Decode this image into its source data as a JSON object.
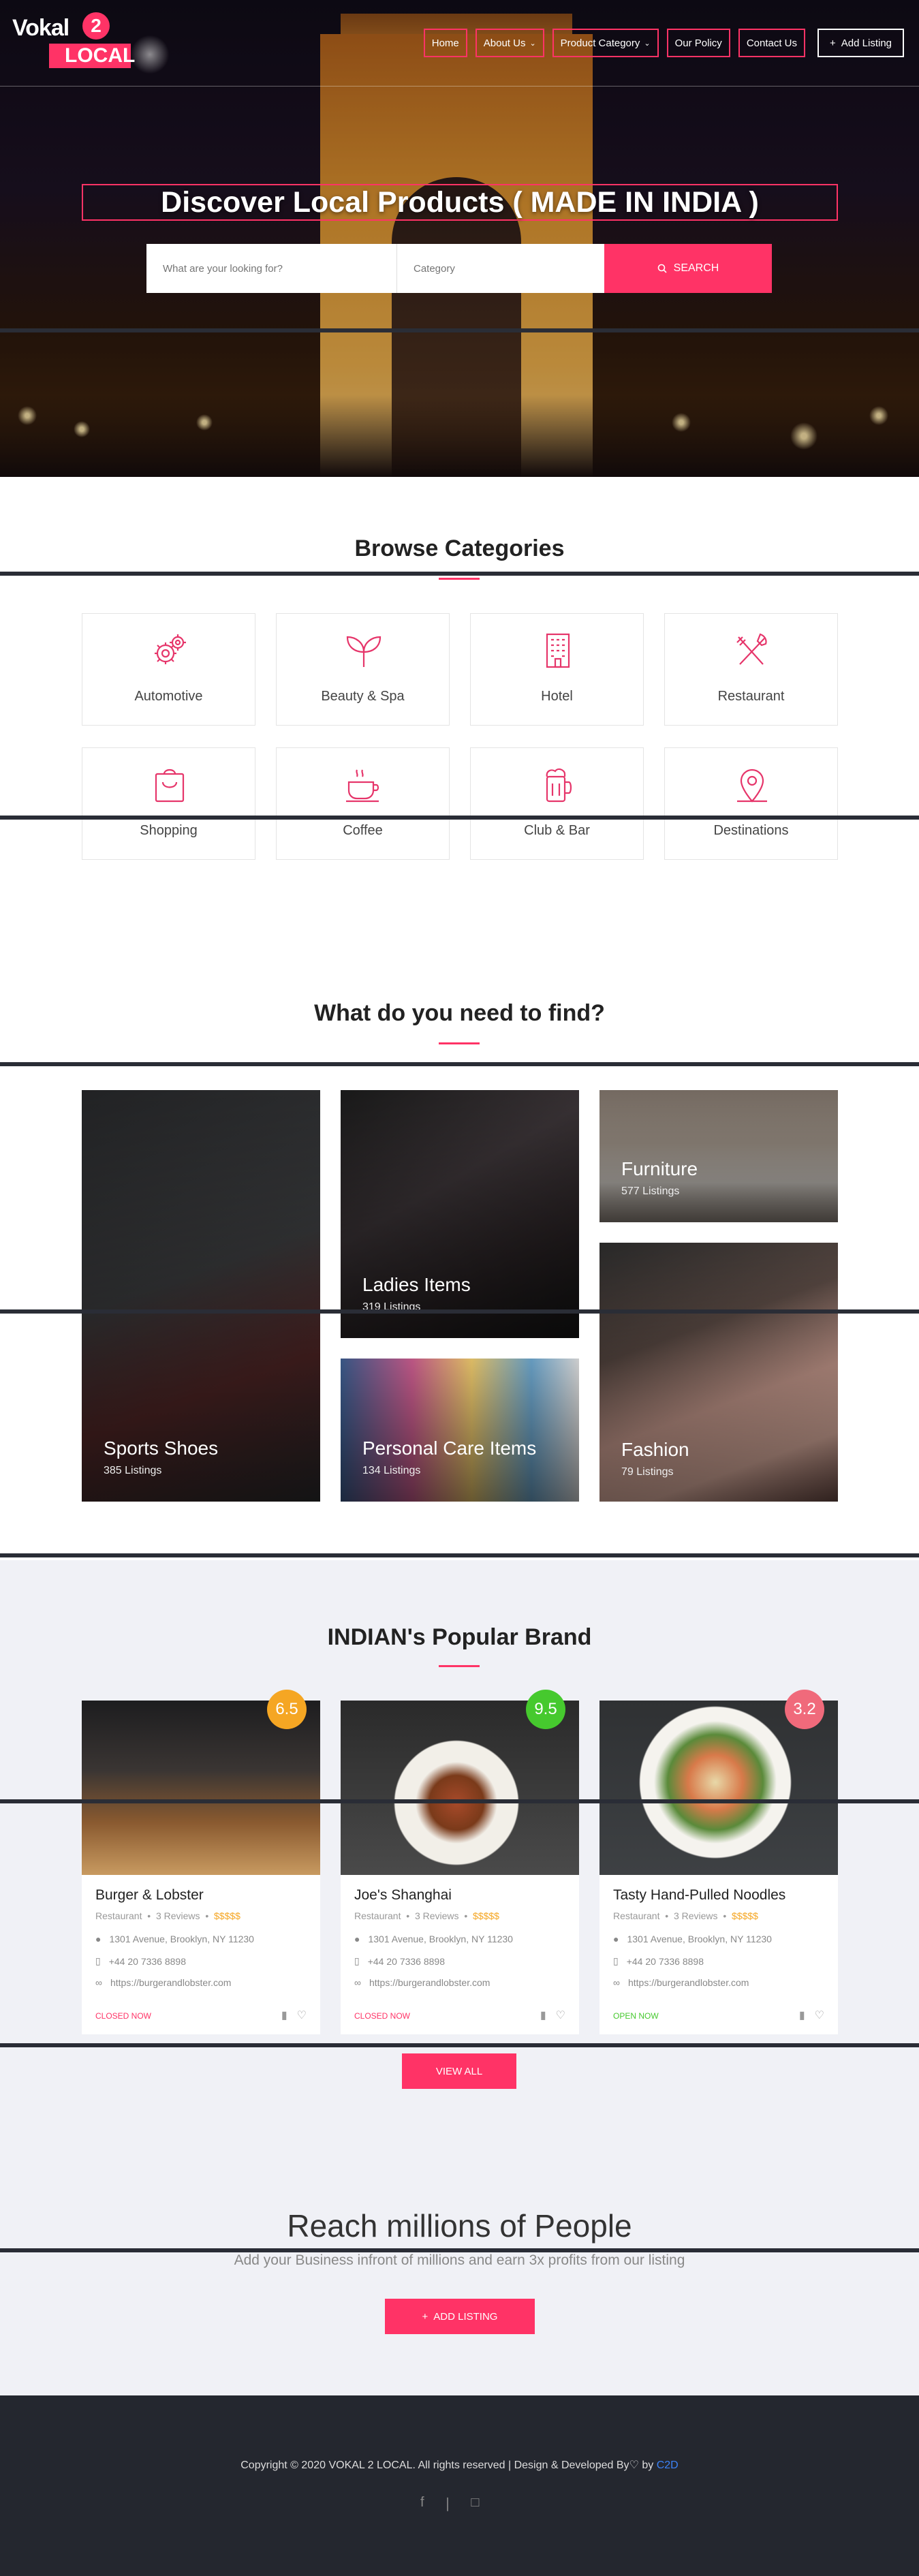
{
  "header": {
    "logo_top": "Vokal",
    "logo_two": "2",
    "logo_bottom": "LOCAL",
    "nav": [
      {
        "label": "Home"
      },
      {
        "label": "About Us"
      },
      {
        "label": "Product Category"
      },
      {
        "label": "Our Policy"
      },
      {
        "label": "Contact Us"
      }
    ],
    "add_listing": "Add Listing"
  },
  "hero": {
    "title": "Discover Local Products ( MADE IN INDIA )",
    "search_placeholder": "What are your looking for?",
    "category_placeholder": "Category",
    "search_button": "SEARCH"
  },
  "categories": {
    "title": "Browse Categories",
    "items": [
      {
        "label": "Automotive",
        "icon": "gears-icon"
      },
      {
        "label": "Beauty & Spa",
        "icon": "leaf-icon"
      },
      {
        "label": "Hotel",
        "icon": "building-icon"
      },
      {
        "label": "Restaurant",
        "icon": "fork-knife-icon"
      },
      {
        "label": "Shopping",
        "icon": "shopping-bag-icon"
      },
      {
        "label": "Coffee",
        "icon": "coffee-cup-icon"
      },
      {
        "label": "Club & Bar",
        "icon": "beer-mug-icon"
      },
      {
        "label": "Destinations",
        "icon": "map-pin-icon"
      }
    ]
  },
  "find": {
    "title": "What do you need to find?",
    "tiles": [
      {
        "title": "Sports Shoes",
        "sub": "385 Listings"
      },
      {
        "title": "Ladies Items",
        "sub": "319 Listings"
      },
      {
        "title": "Furniture",
        "sub": "577 Listings"
      },
      {
        "title": "Personal Care Items",
        "sub": "134 Listings"
      },
      {
        "title": "Fashion",
        "sub": "79 Listings"
      }
    ]
  },
  "brands": {
    "title": "INDIAN's Popular Brand",
    "cards": [
      {
        "score": "6.5",
        "score_color": "#f5a623",
        "name": "Burger & Lobster",
        "type": "Restaurant",
        "reviews": "3 Reviews",
        "price": "$$$$$",
        "address": "1301 Avenue, Brooklyn, NY 11230",
        "phone": "+44 20 7336 8898",
        "url": "https://burgerandlobster.com",
        "status": "CLOSED NOW",
        "status_color": "#ff3366"
      },
      {
        "score": "9.5",
        "score_color": "#46c92e",
        "name": "Joe's Shanghai",
        "type": "Restaurant",
        "reviews": "3 Reviews",
        "price": "$$$$$",
        "address": "1301 Avenue, Brooklyn, NY 11230",
        "phone": "+44 20 7336 8898",
        "url": "https://burgerandlobster.com",
        "status": "CLOSED NOW",
        "status_color": "#ff3366"
      },
      {
        "score": "3.2",
        "score_color": "#f06a7b",
        "name": "Tasty Hand-Pulled Noodles",
        "type": "Restaurant",
        "reviews": "3 Reviews",
        "price": "$$$$$",
        "address": "1301 Avenue, Brooklyn, NY 11230",
        "phone": "+44 20 7336 8898",
        "url": "https://burgerandlobster.com",
        "status": "OPEN NOW",
        "status_color": "#46c92e"
      }
    ],
    "view_all": "VIEW ALL"
  },
  "reach": {
    "title": "Reach millions of People",
    "subtitle": "Add your Business infront of millions and earn 3x profits from our listing",
    "button": "ADD LISTING"
  },
  "footer": {
    "copyright": "Copyright © 2020 VOKAL 2 LOCAL. All rights reserved | Design & Developed By",
    "by": "by",
    "brand": "C2D"
  }
}
